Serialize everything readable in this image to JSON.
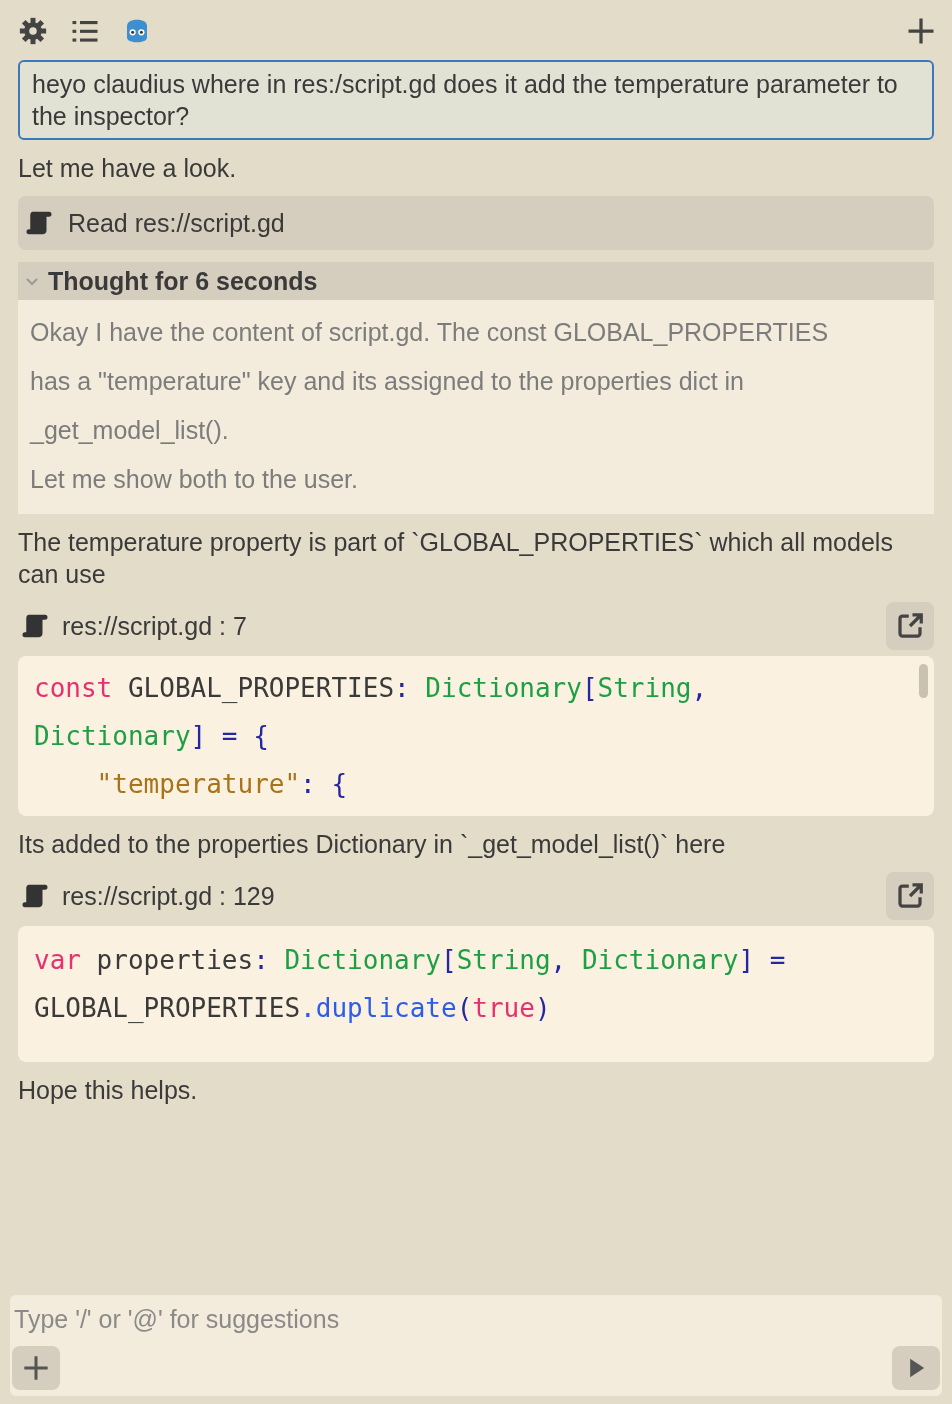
{
  "composer": {
    "placeholder": "Type '/' or '@' for suggestions"
  },
  "messages": [
    {
      "kind": "user",
      "text": "heyo claudius where in res:/script.gd does it add the temperature parameter to the inspector?"
    },
    {
      "kind": "text",
      "text": "Let me have a look."
    },
    {
      "kind": "tool",
      "text": "Read res://script.gd"
    },
    {
      "kind": "thought",
      "title": "Thought for 6 seconds",
      "expanded": true,
      "paragraphs": [
        "Okay I have the content of script.gd. The const GLOBAL_PROPERTIES has a \"temperature\" key and its assigned to the properties dict in _get_model_list().",
        "Let me show both to the user."
      ]
    },
    {
      "kind": "text",
      "text": "The temperature property is part of `GLOBAL_PROPERTIES` which all models can use"
    },
    {
      "kind": "code",
      "file": "res://script.gd : 7",
      "scrolled": true,
      "lines": [
        [
          {
            "kind": "keyword",
            "text": "const"
          },
          {
            "kind": "plain",
            "text": " GLOBAL_PROPERTIES"
          },
          {
            "kind": "punct",
            "text": ": "
          },
          {
            "kind": "type",
            "text": "Dictionary"
          },
          {
            "kind": "punct",
            "text": "["
          },
          {
            "kind": "type",
            "text": "String"
          },
          {
            "kind": "punct",
            "text": ","
          }
        ],
        [
          {
            "kind": "type",
            "text": "Dictionary"
          },
          {
            "kind": "punct",
            "text": "] = {"
          }
        ],
        [
          {
            "kind": "string",
            "text": "    \"temperature\""
          },
          {
            "kind": "punct",
            "text": ": {"
          }
        ]
      ]
    },
    {
      "kind": "text",
      "text": "Its added to the properties Dictionary in `_get_model_list()` here"
    },
    {
      "kind": "code",
      "file": "res://script.gd : 129",
      "scrolled": false,
      "lines": [
        [
          {
            "kind": "keyword",
            "text": "var"
          },
          {
            "kind": "plain",
            "text": " properties"
          },
          {
            "kind": "punct",
            "text": ": "
          },
          {
            "kind": "type",
            "text": "Dictionary"
          },
          {
            "kind": "punct",
            "text": "["
          },
          {
            "kind": "type",
            "text": "String"
          },
          {
            "kind": "punct",
            "text": ", "
          },
          {
            "kind": "type",
            "text": "Dictionary"
          },
          {
            "kind": "punct",
            "text": "] ="
          }
        ],
        [
          {
            "kind": "plain",
            "text": "GLOBAL_PROPERTIES"
          },
          {
            "kind": "method",
            "text": ".duplicate"
          },
          {
            "kind": "punct",
            "text": "("
          },
          {
            "kind": "keyword",
            "text": "true"
          },
          {
            "kind": "punct",
            "text": ")"
          }
        ]
      ]
    },
    {
      "kind": "text",
      "text": "Hope this helps."
    }
  ]
}
